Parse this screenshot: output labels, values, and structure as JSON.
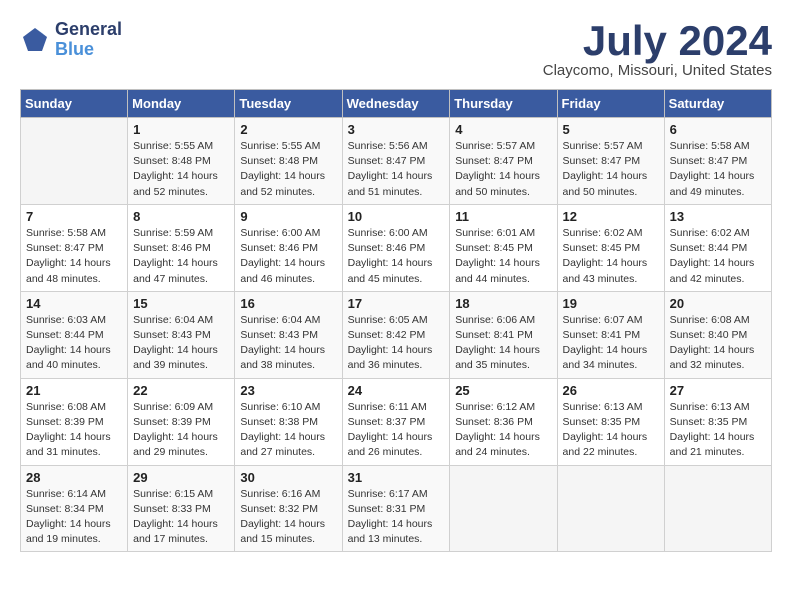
{
  "header": {
    "logo_general": "General",
    "logo_blue": "Blue",
    "title_month": "July 2024",
    "title_location": "Claycomo, Missouri, United States"
  },
  "calendar": {
    "days_of_week": [
      "Sunday",
      "Monday",
      "Tuesday",
      "Wednesday",
      "Thursday",
      "Friday",
      "Saturday"
    ],
    "weeks": [
      [
        {
          "day": "",
          "info": ""
        },
        {
          "day": "1",
          "info": "Sunrise: 5:55 AM\nSunset: 8:48 PM\nDaylight: 14 hours\nand 52 minutes."
        },
        {
          "day": "2",
          "info": "Sunrise: 5:55 AM\nSunset: 8:48 PM\nDaylight: 14 hours\nand 52 minutes."
        },
        {
          "day": "3",
          "info": "Sunrise: 5:56 AM\nSunset: 8:47 PM\nDaylight: 14 hours\nand 51 minutes."
        },
        {
          "day": "4",
          "info": "Sunrise: 5:57 AM\nSunset: 8:47 PM\nDaylight: 14 hours\nand 50 minutes."
        },
        {
          "day": "5",
          "info": "Sunrise: 5:57 AM\nSunset: 8:47 PM\nDaylight: 14 hours\nand 50 minutes."
        },
        {
          "day": "6",
          "info": "Sunrise: 5:58 AM\nSunset: 8:47 PM\nDaylight: 14 hours\nand 49 minutes."
        }
      ],
      [
        {
          "day": "7",
          "info": "Sunrise: 5:58 AM\nSunset: 8:47 PM\nDaylight: 14 hours\nand 48 minutes."
        },
        {
          "day": "8",
          "info": "Sunrise: 5:59 AM\nSunset: 8:46 PM\nDaylight: 14 hours\nand 47 minutes."
        },
        {
          "day": "9",
          "info": "Sunrise: 6:00 AM\nSunset: 8:46 PM\nDaylight: 14 hours\nand 46 minutes."
        },
        {
          "day": "10",
          "info": "Sunrise: 6:00 AM\nSunset: 8:46 PM\nDaylight: 14 hours\nand 45 minutes."
        },
        {
          "day": "11",
          "info": "Sunrise: 6:01 AM\nSunset: 8:45 PM\nDaylight: 14 hours\nand 44 minutes."
        },
        {
          "day": "12",
          "info": "Sunrise: 6:02 AM\nSunset: 8:45 PM\nDaylight: 14 hours\nand 43 minutes."
        },
        {
          "day": "13",
          "info": "Sunrise: 6:02 AM\nSunset: 8:44 PM\nDaylight: 14 hours\nand 42 minutes."
        }
      ],
      [
        {
          "day": "14",
          "info": "Sunrise: 6:03 AM\nSunset: 8:44 PM\nDaylight: 14 hours\nand 40 minutes."
        },
        {
          "day": "15",
          "info": "Sunrise: 6:04 AM\nSunset: 8:43 PM\nDaylight: 14 hours\nand 39 minutes."
        },
        {
          "day": "16",
          "info": "Sunrise: 6:04 AM\nSunset: 8:43 PM\nDaylight: 14 hours\nand 38 minutes."
        },
        {
          "day": "17",
          "info": "Sunrise: 6:05 AM\nSunset: 8:42 PM\nDaylight: 14 hours\nand 36 minutes."
        },
        {
          "day": "18",
          "info": "Sunrise: 6:06 AM\nSunset: 8:41 PM\nDaylight: 14 hours\nand 35 minutes."
        },
        {
          "day": "19",
          "info": "Sunrise: 6:07 AM\nSunset: 8:41 PM\nDaylight: 14 hours\nand 34 minutes."
        },
        {
          "day": "20",
          "info": "Sunrise: 6:08 AM\nSunset: 8:40 PM\nDaylight: 14 hours\nand 32 minutes."
        }
      ],
      [
        {
          "day": "21",
          "info": "Sunrise: 6:08 AM\nSunset: 8:39 PM\nDaylight: 14 hours\nand 31 minutes."
        },
        {
          "day": "22",
          "info": "Sunrise: 6:09 AM\nSunset: 8:39 PM\nDaylight: 14 hours\nand 29 minutes."
        },
        {
          "day": "23",
          "info": "Sunrise: 6:10 AM\nSunset: 8:38 PM\nDaylight: 14 hours\nand 27 minutes."
        },
        {
          "day": "24",
          "info": "Sunrise: 6:11 AM\nSunset: 8:37 PM\nDaylight: 14 hours\nand 26 minutes."
        },
        {
          "day": "25",
          "info": "Sunrise: 6:12 AM\nSunset: 8:36 PM\nDaylight: 14 hours\nand 24 minutes."
        },
        {
          "day": "26",
          "info": "Sunrise: 6:13 AM\nSunset: 8:35 PM\nDaylight: 14 hours\nand 22 minutes."
        },
        {
          "day": "27",
          "info": "Sunrise: 6:13 AM\nSunset: 8:35 PM\nDaylight: 14 hours\nand 21 minutes."
        }
      ],
      [
        {
          "day": "28",
          "info": "Sunrise: 6:14 AM\nSunset: 8:34 PM\nDaylight: 14 hours\nand 19 minutes."
        },
        {
          "day": "29",
          "info": "Sunrise: 6:15 AM\nSunset: 8:33 PM\nDaylight: 14 hours\nand 17 minutes."
        },
        {
          "day": "30",
          "info": "Sunrise: 6:16 AM\nSunset: 8:32 PM\nDaylight: 14 hours\nand 15 minutes."
        },
        {
          "day": "31",
          "info": "Sunrise: 6:17 AM\nSunset: 8:31 PM\nDaylight: 14 hours\nand 13 minutes."
        },
        {
          "day": "",
          "info": ""
        },
        {
          "day": "",
          "info": ""
        },
        {
          "day": "",
          "info": ""
        }
      ]
    ]
  }
}
